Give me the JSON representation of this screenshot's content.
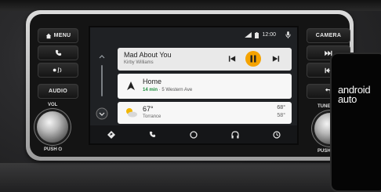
{
  "buttons": {
    "menu": "MENU",
    "audio": "AUDIO",
    "camera": "CAMERA"
  },
  "knobs": {
    "vol_label": "VOL",
    "vol_push": "PUSH ⏻",
    "tune_label": "TUNE",
    "tune_push": "PUSH"
  },
  "status": {
    "time": "12:00"
  },
  "music": {
    "title": "Mad About You",
    "artist": "Kirby Williams"
  },
  "nav": {
    "destination": "Home",
    "eta": "14 min",
    "separator": "·",
    "street": "5 Western Ave"
  },
  "weather": {
    "temp": "67°",
    "city": "Torrance",
    "high": "68°",
    "low": "58°"
  },
  "phone": {
    "logo_line1": "android",
    "logo_line2": "auto"
  },
  "colors": {
    "accent": "#f5a300",
    "eta": "#1e8e3e",
    "screen_bg": "#1f2124"
  }
}
